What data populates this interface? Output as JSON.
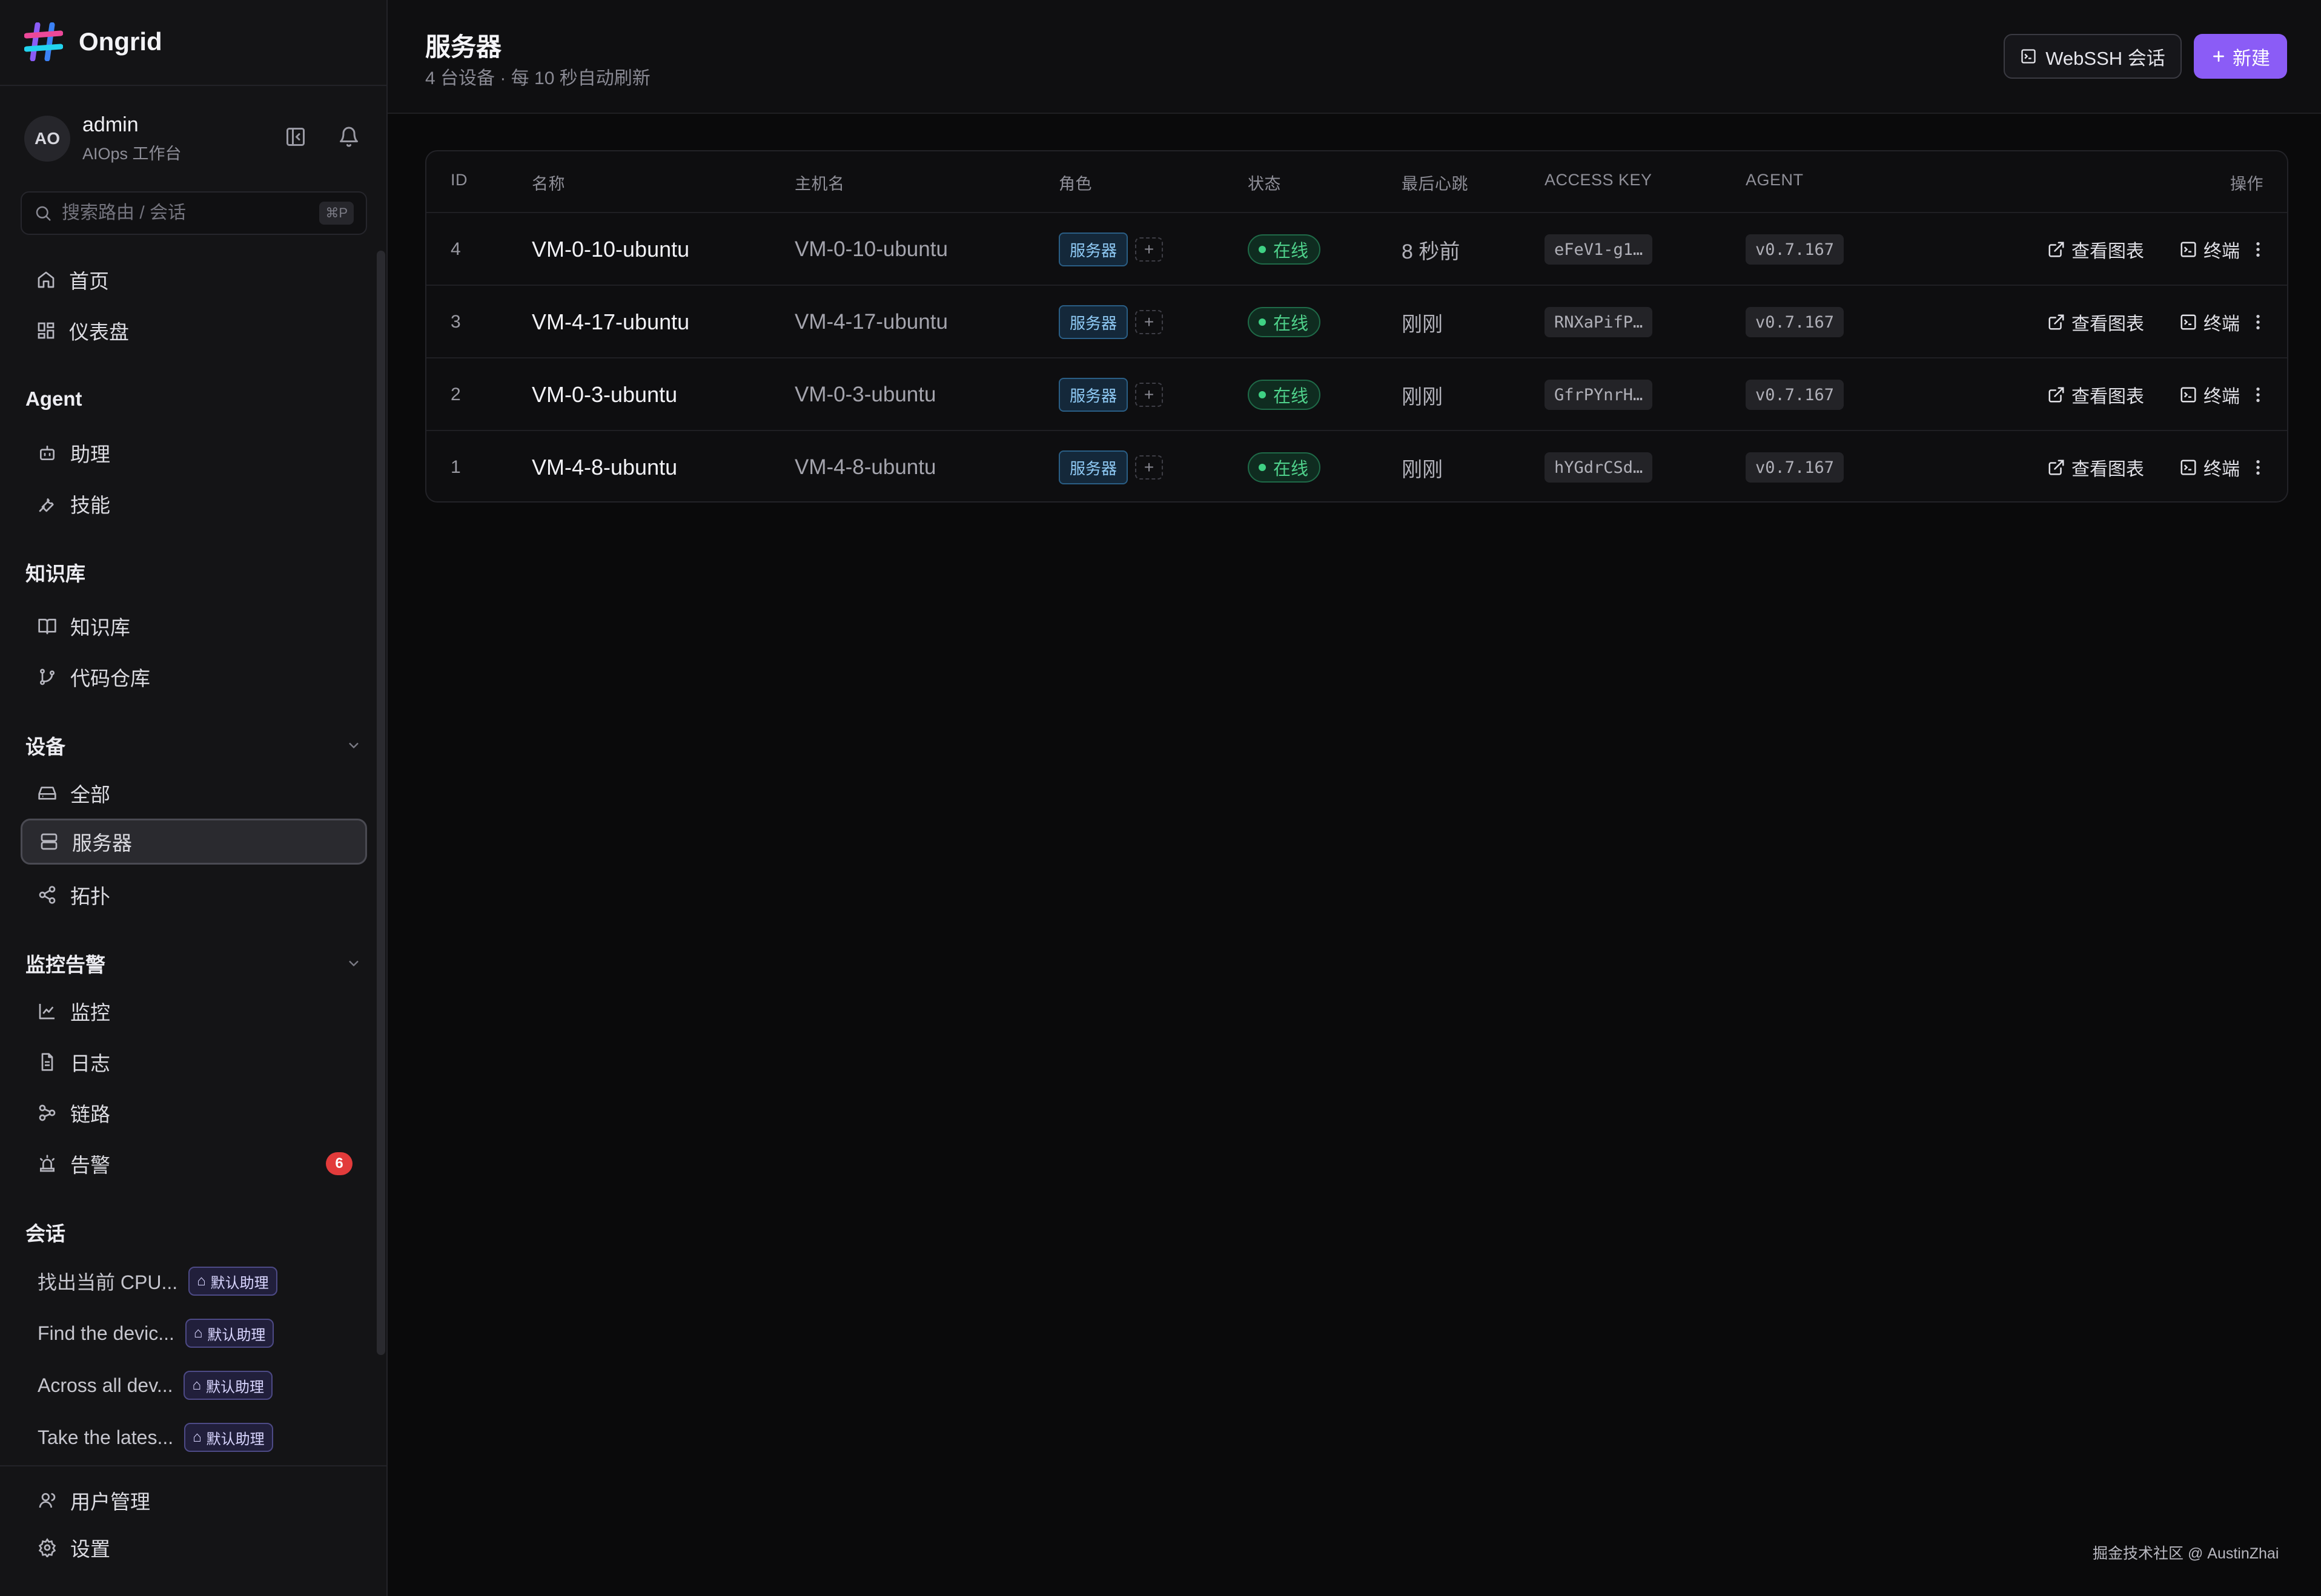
{
  "app": {
    "name": "Ongrid"
  },
  "user": {
    "initials": "AO",
    "name": "admin",
    "subtitle": "AIOps 工作台"
  },
  "search": {
    "placeholder": "搜索路由 / 会话",
    "shortcut": "⌘P"
  },
  "nav": {
    "home": "首页",
    "dashboard": "仪表盘",
    "agent_section": "Agent",
    "assistant": "助理",
    "skills": "技能",
    "kb_section": "知识库",
    "kb": "知识库",
    "code_repo": "代码仓库",
    "devices_section": "设备",
    "all": "全部",
    "servers": "服务器",
    "topology": "拓扑",
    "monitor_section": "监控告警",
    "monitoring": "监控",
    "logs": "日志",
    "traces": "链路",
    "alerts": "告警",
    "alerts_count": "6",
    "conversations_section": "会话",
    "user_mgmt": "用户管理",
    "settings": "设置"
  },
  "conversations": [
    {
      "title": "找出当前 CPU...",
      "tag": "默认助理"
    },
    {
      "title": "Find the devic...",
      "tag": "默认助理"
    },
    {
      "title": "Across all dev...",
      "tag": "默认助理"
    },
    {
      "title": "Take the lates...",
      "tag": "默认助理"
    }
  ],
  "page": {
    "title": "服务器",
    "subtitle": "4 台设备 · 每 10 秒自动刷新",
    "webssh_label": "WebSSH 会话",
    "new_label": "新建"
  },
  "table": {
    "headers": {
      "id": "ID",
      "name": "名称",
      "host": "主机名",
      "role": "角色",
      "status": "状态",
      "heartbeat": "最后心跳",
      "access_key": "ACCESS KEY",
      "agent": "AGENT",
      "ops": "操作"
    },
    "rows": [
      {
        "id": "4",
        "name": "VM-0-10-ubuntu",
        "host": "VM-0-10-ubuntu",
        "role": "服务器",
        "status": "在线",
        "heartbeat": "8 秒前",
        "access_key": "eFeV1-g1…",
        "agent": "v0.7.167",
        "chart": "查看图表",
        "terminal": "终端"
      },
      {
        "id": "3",
        "name": "VM-4-17-ubuntu",
        "host": "VM-4-17-ubuntu",
        "role": "服务器",
        "status": "在线",
        "heartbeat": "刚刚",
        "access_key": "RNXaPifP…",
        "agent": "v0.7.167",
        "chart": "查看图表",
        "terminal": "终端"
      },
      {
        "id": "2",
        "name": "VM-0-3-ubuntu",
        "host": "VM-0-3-ubuntu",
        "role": "服务器",
        "status": "在线",
        "heartbeat": "刚刚",
        "access_key": "GfrPYnrH…",
        "agent": "v0.7.167",
        "chart": "查看图表",
        "terminal": "终端"
      },
      {
        "id": "1",
        "name": "VM-4-8-ubuntu",
        "host": "VM-4-8-ubuntu",
        "role": "服务器",
        "status": "在线",
        "heartbeat": "刚刚",
        "access_key": "hYGdrCSd…",
        "agent": "v0.7.167",
        "chart": "查看图表",
        "terminal": "终端"
      }
    ]
  },
  "watermark": "掘金技术社区 @ AustinZhai",
  "colors": {
    "accent": "#8b5cf6",
    "online": "#4fd18b",
    "alert": "#e23b3b",
    "role": "#8fcaf5"
  }
}
